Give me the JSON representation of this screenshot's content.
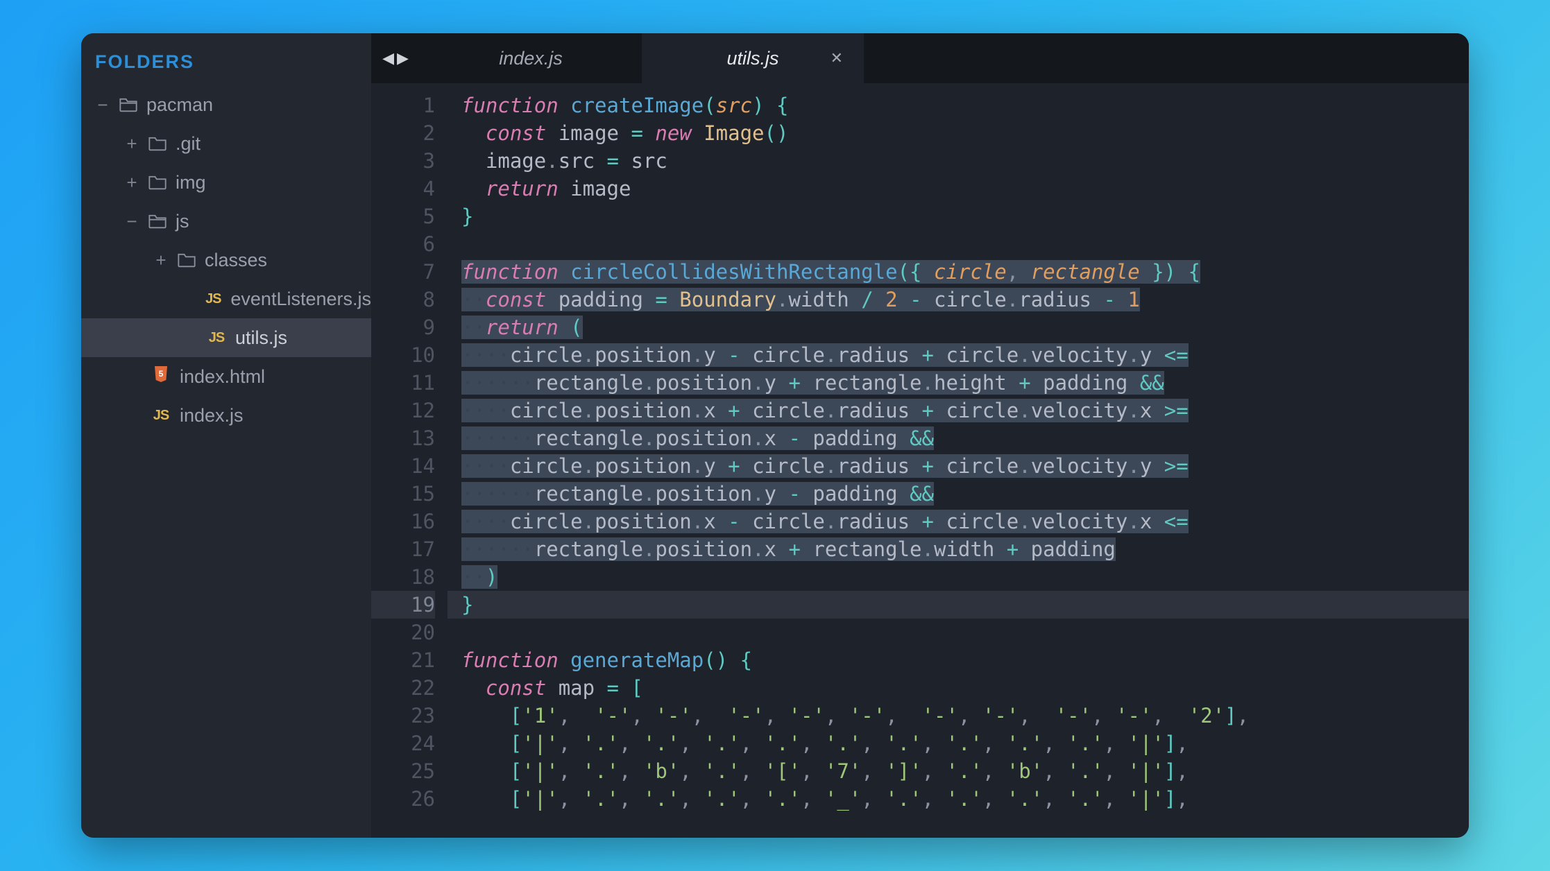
{
  "sidebar": {
    "header": "FOLDERS",
    "tree": [
      {
        "level": 0,
        "expander": "−",
        "icon": "folder-open",
        "label": "pacman"
      },
      {
        "level": 1,
        "expander": "+",
        "icon": "folder",
        "label": ".git"
      },
      {
        "level": 1,
        "expander": "+",
        "icon": "folder",
        "label": "img"
      },
      {
        "level": 1,
        "expander": "−",
        "icon": "folder-open",
        "label": "js"
      },
      {
        "level": 2,
        "expander": "+",
        "icon": "folder",
        "label": "classes"
      },
      {
        "level": 3,
        "expander": "",
        "icon": "js",
        "label": "eventListeners.js"
      },
      {
        "level": 3,
        "expander": "",
        "icon": "js",
        "label": "utils.js",
        "selected": true
      },
      {
        "level": 2,
        "expander": "",
        "icon": "html",
        "label": "index.html",
        "noExpSlot": true
      },
      {
        "level": 2,
        "expander": "",
        "icon": "js",
        "label": "index.js",
        "noExpSlot": true
      }
    ]
  },
  "tabs": {
    "items": [
      {
        "label": "index.js",
        "active": false,
        "close": false
      },
      {
        "label": "utils.js",
        "active": true,
        "close": true
      }
    ],
    "nav_prev": "◀",
    "nav_next": "▶"
  },
  "editor": {
    "lineNumbers": [
      1,
      2,
      3,
      4,
      5,
      6,
      7,
      8,
      9,
      10,
      11,
      12,
      13,
      14,
      15,
      16,
      17,
      18,
      19,
      20,
      21,
      22,
      23,
      24,
      25,
      26
    ],
    "currentLine": 19,
    "highlightRange": [
      7,
      19
    ],
    "code": [
      {
        "t": [
          [
            "kw",
            "function "
          ],
          [
            "fn",
            "createImage"
          ],
          [
            "op",
            "("
          ],
          [
            "param",
            "src"
          ],
          [
            "op",
            ") {"
          ]
        ]
      },
      {
        "t": [
          [
            "",
            "  "
          ],
          [
            "kw",
            "const "
          ],
          [
            "id",
            "image "
          ],
          [
            "op",
            "= "
          ],
          [
            "kw",
            "new "
          ],
          [
            "cls",
            "Image"
          ],
          [
            "op",
            "()"
          ]
        ]
      },
      {
        "t": [
          [
            "",
            "  "
          ],
          [
            "id",
            "image"
          ],
          [
            "pun",
            "."
          ],
          [
            "id",
            "src "
          ],
          [
            "op",
            "= "
          ],
          [
            "id",
            "src"
          ]
        ]
      },
      {
        "t": [
          [
            "",
            "  "
          ],
          [
            "kw",
            "return "
          ],
          [
            "id",
            "image"
          ]
        ]
      },
      {
        "t": [
          [
            "op",
            "}"
          ]
        ]
      },
      {
        "t": [
          [
            "",
            ""
          ]
        ]
      },
      {
        "hl": true,
        "t": [
          [
            "kw",
            "function "
          ],
          [
            "fn",
            "circleCollidesWithRectangle"
          ],
          [
            "op",
            "({ "
          ],
          [
            "param",
            "circle"
          ],
          [
            "pun",
            ", "
          ],
          [
            "param",
            "rectangle"
          ],
          [
            "op",
            " }) {"
          ]
        ]
      },
      {
        "hl": true,
        "t": [
          [
            "dot",
            "··"
          ],
          [
            "kw",
            "const "
          ],
          [
            "id",
            "padding "
          ],
          [
            "op",
            "= "
          ],
          [
            "cls",
            "Boundary"
          ],
          [
            "pun",
            "."
          ],
          [
            "id",
            "width "
          ],
          [
            "op",
            "/ "
          ],
          [
            "num",
            "2"
          ],
          [
            "op",
            " - "
          ],
          [
            "id",
            "circle"
          ],
          [
            "pun",
            "."
          ],
          [
            "id",
            "radius "
          ],
          [
            "op",
            "- "
          ],
          [
            "num",
            "1"
          ]
        ]
      },
      {
        "hl": true,
        "t": [
          [
            "dot",
            "··"
          ],
          [
            "kw",
            "return "
          ],
          [
            "op",
            "("
          ]
        ]
      },
      {
        "hl": true,
        "t": [
          [
            "dot",
            "····"
          ],
          [
            "id",
            "circle"
          ],
          [
            "pun",
            "."
          ],
          [
            "id",
            "position"
          ],
          [
            "pun",
            "."
          ],
          [
            "id",
            "y "
          ],
          [
            "op",
            "- "
          ],
          [
            "id",
            "circle"
          ],
          [
            "pun",
            "."
          ],
          [
            "id",
            "radius "
          ],
          [
            "op",
            "+ "
          ],
          [
            "id",
            "circle"
          ],
          [
            "pun",
            "."
          ],
          [
            "id",
            "velocity"
          ],
          [
            "pun",
            "."
          ],
          [
            "id",
            "y "
          ],
          [
            "op",
            "<="
          ]
        ]
      },
      {
        "hl": true,
        "t": [
          [
            "dot",
            "······"
          ],
          [
            "id",
            "rectangle"
          ],
          [
            "pun",
            "."
          ],
          [
            "id",
            "position"
          ],
          [
            "pun",
            "."
          ],
          [
            "id",
            "y "
          ],
          [
            "op",
            "+ "
          ],
          [
            "id",
            "rectangle"
          ],
          [
            "pun",
            "."
          ],
          [
            "id",
            "height "
          ],
          [
            "op",
            "+ "
          ],
          [
            "id",
            "padding "
          ],
          [
            "op",
            "&&"
          ]
        ]
      },
      {
        "hl": true,
        "t": [
          [
            "dot",
            "····"
          ],
          [
            "id",
            "circle"
          ],
          [
            "pun",
            "."
          ],
          [
            "id",
            "position"
          ],
          [
            "pun",
            "."
          ],
          [
            "id",
            "x "
          ],
          [
            "op",
            "+ "
          ],
          [
            "id",
            "circle"
          ],
          [
            "pun",
            "."
          ],
          [
            "id",
            "radius "
          ],
          [
            "op",
            "+ "
          ],
          [
            "id",
            "circle"
          ],
          [
            "pun",
            "."
          ],
          [
            "id",
            "velocity"
          ],
          [
            "pun",
            "."
          ],
          [
            "id",
            "x "
          ],
          [
            "op",
            ">="
          ]
        ]
      },
      {
        "hl": true,
        "t": [
          [
            "dot",
            "······"
          ],
          [
            "id",
            "rectangle"
          ],
          [
            "pun",
            "."
          ],
          [
            "id",
            "position"
          ],
          [
            "pun",
            "."
          ],
          [
            "id",
            "x "
          ],
          [
            "op",
            "- "
          ],
          [
            "id",
            "padding "
          ],
          [
            "op",
            "&&"
          ]
        ]
      },
      {
        "hl": true,
        "t": [
          [
            "dot",
            "····"
          ],
          [
            "id",
            "circle"
          ],
          [
            "pun",
            "."
          ],
          [
            "id",
            "position"
          ],
          [
            "pun",
            "."
          ],
          [
            "id",
            "y "
          ],
          [
            "op",
            "+ "
          ],
          [
            "id",
            "circle"
          ],
          [
            "pun",
            "."
          ],
          [
            "id",
            "radius "
          ],
          [
            "op",
            "+ "
          ],
          [
            "id",
            "circle"
          ],
          [
            "pun",
            "."
          ],
          [
            "id",
            "velocity"
          ],
          [
            "pun",
            "."
          ],
          [
            "id",
            "y "
          ],
          [
            "op",
            ">="
          ]
        ]
      },
      {
        "hl": true,
        "t": [
          [
            "dot",
            "······"
          ],
          [
            "id",
            "rectangle"
          ],
          [
            "pun",
            "."
          ],
          [
            "id",
            "position"
          ],
          [
            "pun",
            "."
          ],
          [
            "id",
            "y "
          ],
          [
            "op",
            "- "
          ],
          [
            "id",
            "padding "
          ],
          [
            "op",
            "&&"
          ]
        ]
      },
      {
        "hl": true,
        "t": [
          [
            "dot",
            "····"
          ],
          [
            "id",
            "circle"
          ],
          [
            "pun",
            "."
          ],
          [
            "id",
            "position"
          ],
          [
            "pun",
            "."
          ],
          [
            "id",
            "x "
          ],
          [
            "op",
            "- "
          ],
          [
            "id",
            "circle"
          ],
          [
            "pun",
            "."
          ],
          [
            "id",
            "radius "
          ],
          [
            "op",
            "+ "
          ],
          [
            "id",
            "circle"
          ],
          [
            "pun",
            "."
          ],
          [
            "id",
            "velocity"
          ],
          [
            "pun",
            "."
          ],
          [
            "id",
            "x "
          ],
          [
            "op",
            "<="
          ]
        ]
      },
      {
        "hl": true,
        "t": [
          [
            "dot",
            "······"
          ],
          [
            "id",
            "rectangle"
          ],
          [
            "pun",
            "."
          ],
          [
            "id",
            "position"
          ],
          [
            "pun",
            "."
          ],
          [
            "id",
            "x "
          ],
          [
            "op",
            "+ "
          ],
          [
            "id",
            "rectangle"
          ],
          [
            "pun",
            "."
          ],
          [
            "id",
            "width "
          ],
          [
            "op",
            "+ "
          ],
          [
            "id",
            "padding"
          ]
        ]
      },
      {
        "hl": true,
        "t": [
          [
            "dot",
            "··"
          ],
          [
            "op",
            ")"
          ]
        ]
      },
      {
        "cur": true,
        "t": [
          [
            "op",
            "}"
          ]
        ]
      },
      {
        "t": [
          [
            "",
            ""
          ]
        ]
      },
      {
        "t": [
          [
            "kw",
            "function "
          ],
          [
            "fn",
            "generateMap"
          ],
          [
            "op",
            "() {"
          ]
        ]
      },
      {
        "t": [
          [
            "",
            "  "
          ],
          [
            "kw",
            "const "
          ],
          [
            "id",
            "map "
          ],
          [
            "op",
            "= ["
          ]
        ]
      },
      {
        "t": [
          [
            "",
            "    "
          ],
          [
            "op",
            "["
          ],
          [
            "str",
            "'1'"
          ],
          [
            "pun",
            ",  "
          ],
          [
            "str",
            "'-'"
          ],
          [
            "pun",
            ", "
          ],
          [
            "str",
            "'-'"
          ],
          [
            "pun",
            ",  "
          ],
          [
            "str",
            "'-'"
          ],
          [
            "pun",
            ", "
          ],
          [
            "str",
            "'-'"
          ],
          [
            "pun",
            ", "
          ],
          [
            "str",
            "'-'"
          ],
          [
            "pun",
            ",  "
          ],
          [
            "str",
            "'-'"
          ],
          [
            "pun",
            ", "
          ],
          [
            "str",
            "'-'"
          ],
          [
            "pun",
            ",  "
          ],
          [
            "str",
            "'-'"
          ],
          [
            "pun",
            ", "
          ],
          [
            "str",
            "'-'"
          ],
          [
            "pun",
            ",  "
          ],
          [
            "str",
            "'2'"
          ],
          [
            "op",
            "]"
          ],
          [
            "pun",
            ","
          ]
        ]
      },
      {
        "t": [
          [
            "",
            "    "
          ],
          [
            "op",
            "["
          ],
          [
            "str",
            "'|'"
          ],
          [
            "pun",
            ", "
          ],
          [
            "str",
            "'.'"
          ],
          [
            "pun",
            ", "
          ],
          [
            "str",
            "'.'"
          ],
          [
            "pun",
            ", "
          ],
          [
            "str",
            "'.'"
          ],
          [
            "pun",
            ", "
          ],
          [
            "str",
            "'.'"
          ],
          [
            "pun",
            ", "
          ],
          [
            "str",
            "'.'"
          ],
          [
            "pun",
            ", "
          ],
          [
            "str",
            "'.'"
          ],
          [
            "pun",
            ", "
          ],
          [
            "str",
            "'.'"
          ],
          [
            "pun",
            ", "
          ],
          [
            "str",
            "'.'"
          ],
          [
            "pun",
            ", "
          ],
          [
            "str",
            "'.'"
          ],
          [
            "pun",
            ", "
          ],
          [
            "str",
            "'|'"
          ],
          [
            "op",
            "]"
          ],
          [
            "pun",
            ","
          ]
        ]
      },
      {
        "t": [
          [
            "",
            "    "
          ],
          [
            "op",
            "["
          ],
          [
            "str",
            "'|'"
          ],
          [
            "pun",
            ", "
          ],
          [
            "str",
            "'.'"
          ],
          [
            "pun",
            ", "
          ],
          [
            "str",
            "'b'"
          ],
          [
            "pun",
            ", "
          ],
          [
            "str",
            "'.'"
          ],
          [
            "pun",
            ", "
          ],
          [
            "str",
            "'['"
          ],
          [
            "pun",
            ", "
          ],
          [
            "str",
            "'7'"
          ],
          [
            "pun",
            ", "
          ],
          [
            "str",
            "']'"
          ],
          [
            "pun",
            ", "
          ],
          [
            "str",
            "'.'"
          ],
          [
            "pun",
            ", "
          ],
          [
            "str",
            "'b'"
          ],
          [
            "pun",
            ", "
          ],
          [
            "str",
            "'.'"
          ],
          [
            "pun",
            ", "
          ],
          [
            "str",
            "'|'"
          ],
          [
            "op",
            "]"
          ],
          [
            "pun",
            ","
          ]
        ]
      },
      {
        "t": [
          [
            "",
            "    "
          ],
          [
            "op",
            "["
          ],
          [
            "str",
            "'|'"
          ],
          [
            "pun",
            ", "
          ],
          [
            "str",
            "'.'"
          ],
          [
            "pun",
            ", "
          ],
          [
            "str",
            "'.'"
          ],
          [
            "pun",
            ", "
          ],
          [
            "str",
            "'.'"
          ],
          [
            "pun",
            ", "
          ],
          [
            "str",
            "'.'"
          ],
          [
            "pun",
            ", "
          ],
          [
            "str",
            "'_'"
          ],
          [
            "pun",
            ", "
          ],
          [
            "str",
            "'.'"
          ],
          [
            "pun",
            ", "
          ],
          [
            "str",
            "'.'"
          ],
          [
            "pun",
            ", "
          ],
          [
            "str",
            "'.'"
          ],
          [
            "pun",
            ", "
          ],
          [
            "str",
            "'.'"
          ],
          [
            "pun",
            ", "
          ],
          [
            "str",
            "'|'"
          ],
          [
            "op",
            "]"
          ],
          [
            "pun",
            ","
          ]
        ]
      }
    ]
  }
}
